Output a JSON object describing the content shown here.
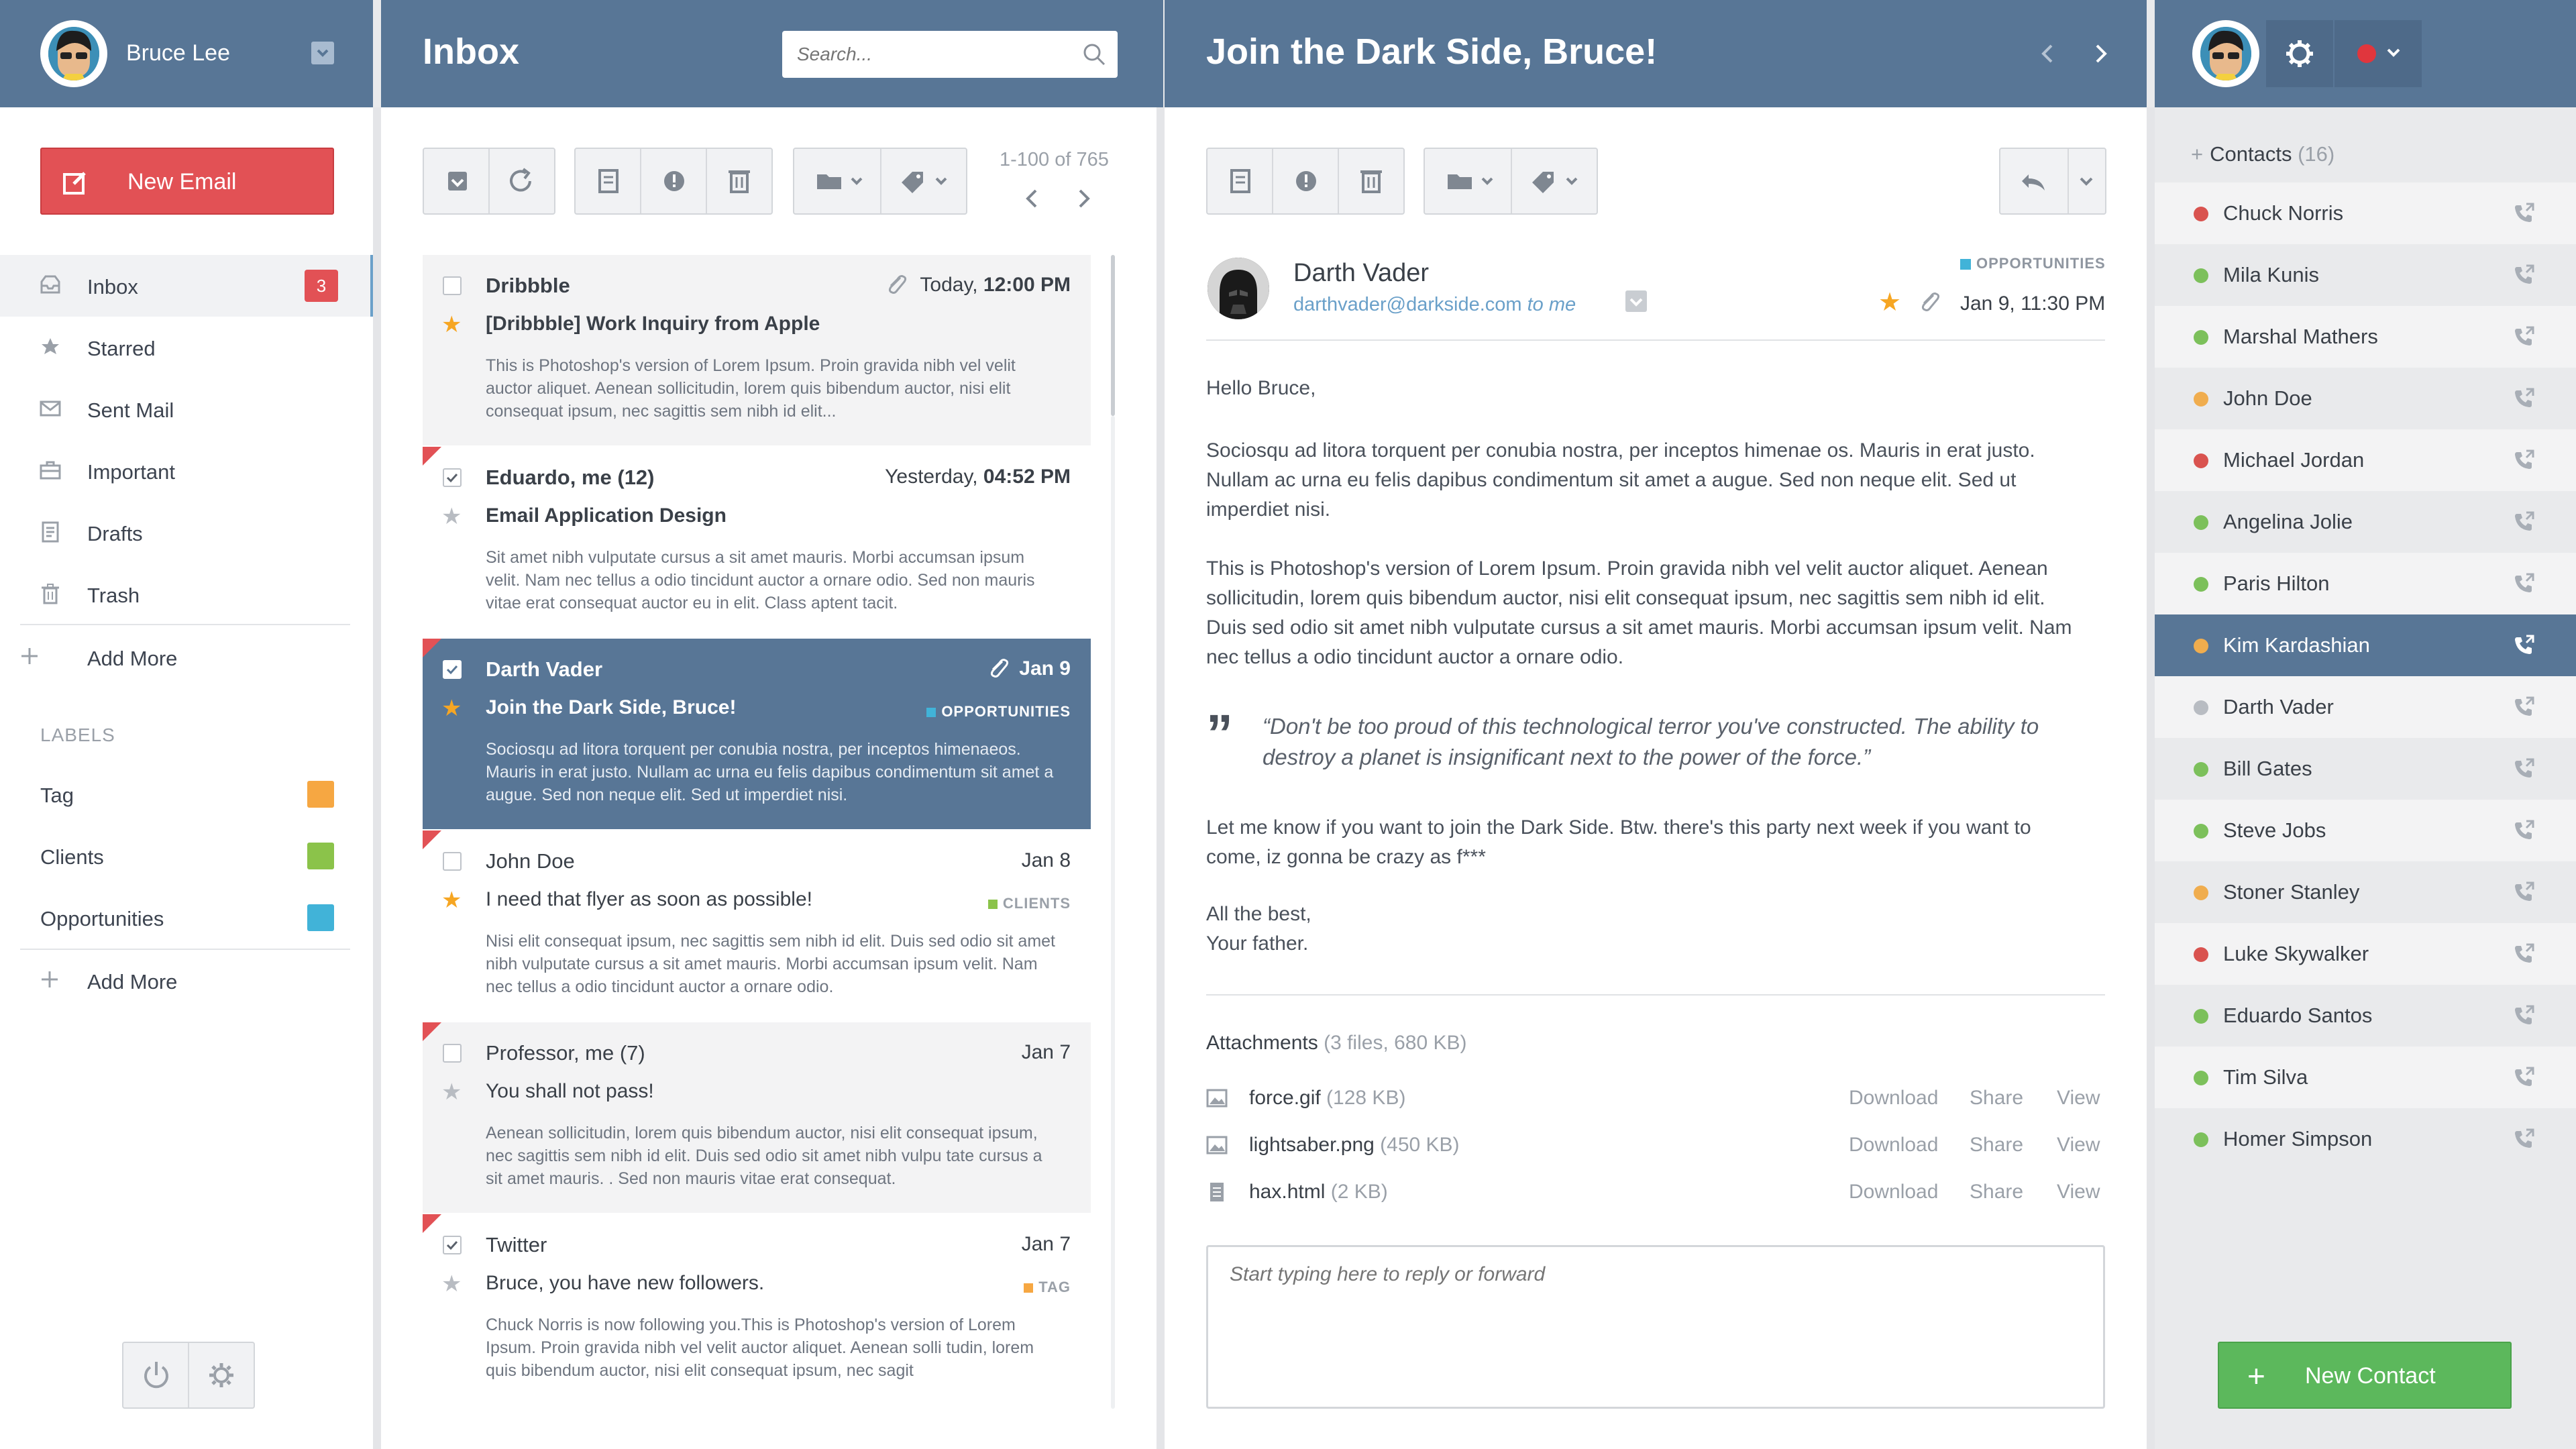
{
  "user": {
    "name": "Bruce Lee"
  },
  "sidebar": {
    "new_email_label": "New Email",
    "items": [
      {
        "label": "Inbox",
        "icon": "inbox-icon",
        "badge": "3"
      },
      {
        "label": "Starred",
        "icon": "star-icon"
      },
      {
        "label": "Sent Mail",
        "icon": "envelope-icon"
      },
      {
        "label": "Important",
        "icon": "briefcase-icon"
      },
      {
        "label": "Drafts",
        "icon": "draft-icon"
      },
      {
        "label": "Trash",
        "icon": "trash-icon"
      }
    ],
    "add_more_label": "Add More",
    "labels_heading": "LABELS",
    "labels": [
      {
        "label": "Tag",
        "color": "#f6a742"
      },
      {
        "label": "Clients",
        "color": "#8bc34a"
      },
      {
        "label": "Opportunities",
        "color": "#41b3d8"
      }
    ],
    "labels_add_more": "Add More"
  },
  "inbox": {
    "title": "Inbox",
    "search_placeholder": "Search...",
    "count_text": "1-100 of 765",
    "emails": [
      {
        "from": "Dribbble",
        "date_prefix": "Today, ",
        "date_bold": "12:00 PM",
        "subject": "[Dribbble] Work Inquiry from Apple",
        "body": "This is Photoshop's version  of Lorem Ipsum. Proin gravida nibh vel velit auctor aliquet. Aenean sollicitudin, lorem quis bibendum auctor, nisi elit consequat ipsum, nec sagittis sem nibh id elit...",
        "tag": ""
      },
      {
        "from": "Eduardo, me (12)",
        "date_prefix": "Yesterday, ",
        "date_bold": "04:52 PM",
        "subject": "Email Application Design",
        "body": "Sit amet nibh vulputate cursus a sit amet mauris. Morbi accumsan ipsum velit. Nam nec tellus a odio tincidunt auctor a ornare odio. Sed non  mauris vitae erat consequat auctor eu in elit. Class aptent tacit.",
        "tag": ""
      },
      {
        "from": "Darth Vader",
        "date_prefix": "",
        "date_bold": "Jan 9",
        "subject": "Join the Dark Side, Bruce!",
        "body": "Sociosqu ad litora torquent per conubia nostra, per inceptos himenaeos. Mauris in erat justo. Nullam ac urna eu felis dapibus condimentum sit amet a augue. Sed non neque elit. Sed ut imperdiet nisi.",
        "tag": "OPPORTUNITIES"
      },
      {
        "from": "John Doe",
        "date_prefix": "",
        "date_bold": "Jan 8",
        "subject": "I need that flyer as soon as possible!",
        "body": "Nisi elit consequat ipsum, nec sagittis sem nibh id elit. Duis sed odio sit amet nibh vulputate cursus a sit amet mauris. Morbi accumsan ipsum velit. Nam nec tellus a odio tincidunt auctor a ornare odio.",
        "tag": "CLIENTS"
      },
      {
        "from": "Professor, me (7)",
        "date_prefix": "",
        "date_bold": "Jan 7",
        "subject": "You shall not pass!",
        "body": "Aenean sollicitudin, lorem quis bibendum auctor, nisi elit consequat ipsum, nec sagittis sem nibh id elit. Duis sed odio sit amet nibh vulpu tate cursus a sit amet mauris. . Sed non  mauris vitae erat consequat.",
        "tag": ""
      },
      {
        "from": "Twitter",
        "date_prefix": "",
        "date_bold": "Jan 7",
        "subject": "Bruce, you have new followers.",
        "body": "Chuck Norris is now following you.This is Photoshop's version  of Lorem Ipsum. Proin gravida nibh vel velit auctor aliquet. Aenean solli tudin, lorem quis bibendum auctor, nisi elit consequat ipsum, nec sagit",
        "tag": "TAG"
      }
    ]
  },
  "message": {
    "title": "Join the Dark Side, Bruce!",
    "sender": "Darth Vader",
    "sender_email": "darthvader@darkside.com",
    "to_text": " to me",
    "tag": "OPPORTUNITIES",
    "date_prefix": "Jan 9, ",
    "date_bold": "11:30 PM",
    "greeting": "Hello Bruce,",
    "para1": "Sociosqu ad litora torquent per conubia nostra, per inceptos himenae os. Mauris in erat justo. Nullam ac urna eu felis dapibus condimentum sit amet a augue. Sed non neque elit. Sed ut imperdiet nisi.",
    "para2": "This is Photoshop's version  of Lorem Ipsum. Proin gravida nibh vel velit auctor aliquet. Aenean sollicitudin, lorem quis bibendum auctor, nisi elit consequat ipsum, nec sagittis sem nibh id elit. Duis sed odio sit amet nibh vulputate cursus a sit amet mauris. Morbi accumsan ipsum velit. Nam nec tellus a odio tincidunt auctor a ornare odio.",
    "quote": "“Don't be too proud of this technological terror you've constructed. The ability to destroy a planet is insignificant next to the power of the force.”",
    "para3": "Let me know if you want to join the Dark Side. Btw. there's this party next week if you want to come, iz gonna be crazy as f***",
    "signoff1": "All the best,",
    "signoff2": "Your father.",
    "attachments_label": "Attachments",
    "attachments_meta": " (3 files, 680 KB)",
    "attachments": [
      {
        "name": "force.gif",
        "size": " (128 KB)",
        "icon": "image-file-icon"
      },
      {
        "name": "lightsaber.png",
        "size": " (450 KB)",
        "icon": "image-file-icon"
      },
      {
        "name": "hax.html",
        "size": " (2 KB)",
        "icon": "document-file-icon"
      }
    ],
    "att_actions": {
      "download": "Download",
      "share": "Share",
      "view": "View"
    },
    "reply_placeholder": "Start typing here to reply or forward"
  },
  "contacts": {
    "header_label": "Contacts",
    "count": " (16)",
    "new_contact_label": "New Contact",
    "list": [
      {
        "name": "Chuck Norris",
        "status": "#d9534f"
      },
      {
        "name": "Mila Kunis",
        "status": "#7cc05b"
      },
      {
        "name": "Marshal Mathers",
        "status": "#7cc05b"
      },
      {
        "name": "John Doe",
        "status": "#f0ad4e"
      },
      {
        "name": "Michael Jordan",
        "status": "#d9534f"
      },
      {
        "name": "Angelina Jolie",
        "status": "#7cc05b"
      },
      {
        "name": "Paris Hilton",
        "status": "#7cc05b"
      },
      {
        "name": "Kim Kardashian",
        "status": "#f0ad4e"
      },
      {
        "name": "Darth Vader",
        "status": "#b8bcc2"
      },
      {
        "name": "Bill Gates",
        "status": "#7cc05b"
      },
      {
        "name": "Steve Jobs",
        "status": "#7cc05b"
      },
      {
        "name": "Stoner Stanley",
        "status": "#f0ad4e"
      },
      {
        "name": "Luke Skywalker",
        "status": "#d9534f"
      },
      {
        "name": "Eduardo Santos",
        "status": "#7cc05b"
      },
      {
        "name": "Tim Silva",
        "status": "#7cc05b"
      },
      {
        "name": "Homer Simpson",
        "status": "#7cc05b"
      }
    ]
  },
  "colors": {
    "header": "#587696",
    "accent_red": "#e25155",
    "green": "#5cb85c",
    "star": "#f6a623"
  }
}
